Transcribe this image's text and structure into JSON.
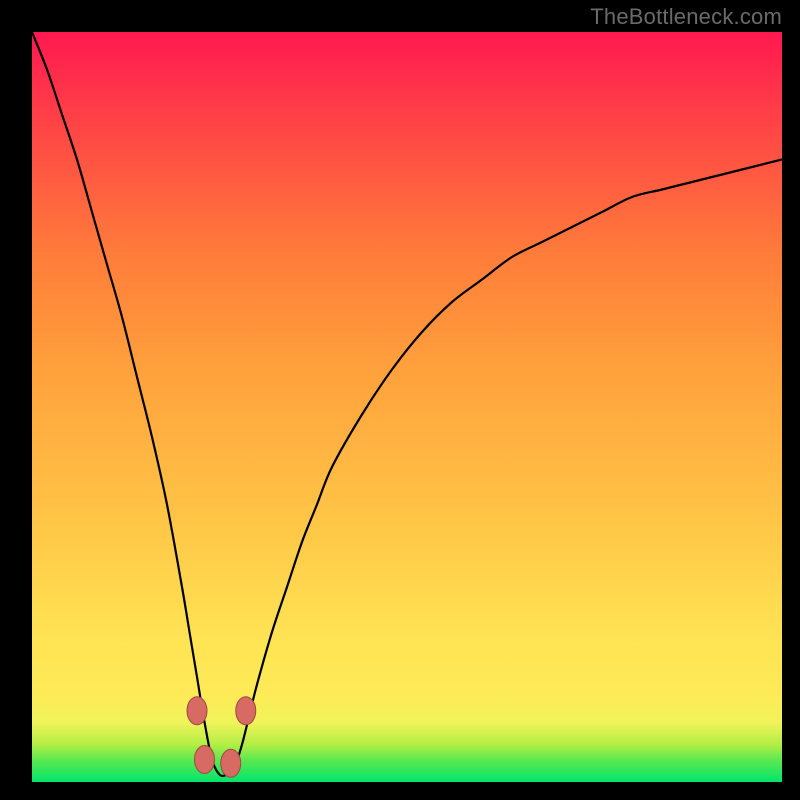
{
  "watermark": {
    "text": "TheBottleneck.com"
  },
  "colors": {
    "black": "#000000",
    "curve": "#000000",
    "dot_fill": "#d76a63",
    "dot_stroke": "#a14842",
    "gradient_stops": [
      {
        "offset": 0.0,
        "color": "#00e56a"
      },
      {
        "offset": 0.03,
        "color": "#5fe94f"
      },
      {
        "offset": 0.05,
        "color": "#b4ee45"
      },
      {
        "offset": 0.08,
        "color": "#f1f35a"
      },
      {
        "offset": 0.12,
        "color": "#feea57"
      },
      {
        "offset": 0.2,
        "color": "#ffe253"
      },
      {
        "offset": 0.35,
        "color": "#ffc546"
      },
      {
        "offset": 0.55,
        "color": "#ffa13c"
      },
      {
        "offset": 0.7,
        "color": "#ff7d3a"
      },
      {
        "offset": 0.85,
        "color": "#ff4d44"
      },
      {
        "offset": 1.0,
        "color": "#ff1850"
      }
    ]
  },
  "chart_data": {
    "type": "line",
    "title": "",
    "xlabel": "",
    "ylabel": "",
    "xlim": [
      0,
      100
    ],
    "ylim": [
      0,
      100
    ],
    "grid": false,
    "legend": false,
    "description": "Single V-shaped bottleneck curve with minimum near x≈25; background hue encodes y-value (green low, red high).",
    "series": [
      {
        "name": "bottleneck-curve",
        "x": [
          0,
          2,
          4,
          6,
          8,
          10,
          12,
          14,
          16,
          18,
          20,
          21,
          22,
          23,
          24,
          25,
          26,
          27,
          28,
          29,
          30,
          32,
          34,
          36,
          38,
          40,
          44,
          48,
          52,
          56,
          60,
          64,
          68,
          72,
          76,
          80,
          84,
          88,
          92,
          96,
          100
        ],
        "values": [
          100,
          95,
          89,
          83,
          76,
          69,
          62,
          54,
          46,
          37,
          26,
          20,
          14,
          8,
          3,
          1,
          1,
          2,
          5,
          9,
          13,
          20,
          26,
          32,
          37,
          42,
          49,
          55,
          60,
          64,
          67,
          70,
          72,
          74,
          76,
          78,
          79,
          80,
          81,
          82,
          83
        ]
      }
    ],
    "markers": [
      {
        "x": 22.0,
        "y": 9.5
      },
      {
        "x": 23.0,
        "y": 3.0
      },
      {
        "x": 26.5,
        "y": 2.5
      },
      {
        "x": 28.5,
        "y": 9.5
      }
    ]
  }
}
